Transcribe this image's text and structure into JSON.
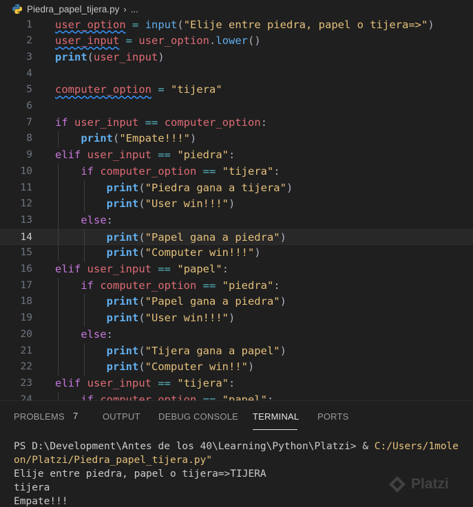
{
  "breadcrumb": {
    "filename": "Piedra_papel_tijera.py",
    "chevron": "›",
    "ellipsis": "..."
  },
  "editor": {
    "current_line": 14,
    "lines": [
      {
        "n": "1",
        "tokens": [
          [
            "v",
            "user_option"
          ],
          [
            "p",
            " "
          ],
          [
            "o",
            "="
          ],
          [
            "p",
            " "
          ],
          [
            "f",
            "input"
          ],
          [
            "p",
            "("
          ],
          [
            "s",
            "\"Elije entre piedra, papel o tijera=>\""
          ],
          [
            "p",
            ")"
          ]
        ]
      },
      {
        "n": "2",
        "tokens": [
          [
            "v",
            "user_input"
          ],
          [
            "p",
            " "
          ],
          [
            "o",
            "="
          ],
          [
            "p",
            " "
          ],
          [
            "v",
            "user_option"
          ],
          [
            "p",
            "."
          ],
          [
            "f",
            "lower"
          ],
          [
            "p",
            "()"
          ]
        ]
      },
      {
        "n": "3",
        "tokens": [
          [
            "b",
            "print"
          ],
          [
            "p",
            "("
          ],
          [
            "v",
            "user_input"
          ],
          [
            "p",
            ")"
          ]
        ]
      },
      {
        "n": "4",
        "tokens": []
      },
      {
        "n": "5",
        "tokens": [
          [
            "v",
            "computer_option"
          ],
          [
            "p",
            " "
          ],
          [
            "o",
            "="
          ],
          [
            "p",
            " "
          ],
          [
            "s",
            "\"tijera\""
          ]
        ]
      },
      {
        "n": "6",
        "tokens": []
      },
      {
        "n": "7",
        "tokens": [
          [
            "k",
            "if"
          ],
          [
            "p",
            " "
          ],
          [
            "v",
            "user_input"
          ],
          [
            "p",
            " "
          ],
          [
            "o",
            "=="
          ],
          [
            "p",
            " "
          ],
          [
            "v",
            "computer_option"
          ],
          [
            "p",
            ":"
          ]
        ]
      },
      {
        "n": "8",
        "tokens": [
          [
            "p",
            "    "
          ],
          [
            "b",
            "print"
          ],
          [
            "p",
            "("
          ],
          [
            "s",
            "\"Empate!!!\""
          ],
          [
            "p",
            ")"
          ]
        ]
      },
      {
        "n": "9",
        "tokens": [
          [
            "k",
            "elif"
          ],
          [
            "p",
            " "
          ],
          [
            "v",
            "user_input"
          ],
          [
            "p",
            " "
          ],
          [
            "o",
            "=="
          ],
          [
            "p",
            " "
          ],
          [
            "s",
            "\"piedra\""
          ],
          [
            "p",
            ":"
          ]
        ]
      },
      {
        "n": "10",
        "tokens": [
          [
            "p",
            "    "
          ],
          [
            "k",
            "if"
          ],
          [
            "p",
            " "
          ],
          [
            "v",
            "computer_option"
          ],
          [
            "p",
            " "
          ],
          [
            "o",
            "=="
          ],
          [
            "p",
            " "
          ],
          [
            "s",
            "\"tijera\""
          ],
          [
            "p",
            ":"
          ]
        ]
      },
      {
        "n": "11",
        "tokens": [
          [
            "p",
            "        "
          ],
          [
            "b",
            "print"
          ],
          [
            "p",
            "("
          ],
          [
            "s",
            "\"Piedra gana a tijera\""
          ],
          [
            "p",
            ")"
          ]
        ]
      },
      {
        "n": "12",
        "tokens": [
          [
            "p",
            "        "
          ],
          [
            "b",
            "print"
          ],
          [
            "p",
            "("
          ],
          [
            "s",
            "\"User win!!!\""
          ],
          [
            "p",
            ")"
          ]
        ]
      },
      {
        "n": "13",
        "tokens": [
          [
            "p",
            "    "
          ],
          [
            "k",
            "else"
          ],
          [
            "p",
            ":"
          ]
        ]
      },
      {
        "n": "14",
        "tokens": [
          [
            "p",
            "        "
          ],
          [
            "b",
            "print"
          ],
          [
            "p",
            "("
          ],
          [
            "s",
            "\"Papel gana a piedra\""
          ],
          [
            "p",
            ")"
          ]
        ]
      },
      {
        "n": "15",
        "tokens": [
          [
            "p",
            "        "
          ],
          [
            "b",
            "print"
          ],
          [
            "p",
            "("
          ],
          [
            "s",
            "\"Computer win!!!\""
          ],
          [
            "p",
            ")"
          ]
        ]
      },
      {
        "n": "16",
        "tokens": [
          [
            "k",
            "elif"
          ],
          [
            "p",
            " "
          ],
          [
            "v",
            "user_input"
          ],
          [
            "p",
            " "
          ],
          [
            "o",
            "=="
          ],
          [
            "p",
            " "
          ],
          [
            "s",
            "\"papel\""
          ],
          [
            "p",
            ":"
          ]
        ]
      },
      {
        "n": "17",
        "tokens": [
          [
            "p",
            "    "
          ],
          [
            "k",
            "if"
          ],
          [
            "p",
            " "
          ],
          [
            "v",
            "computer_option"
          ],
          [
            "p",
            " "
          ],
          [
            "o",
            "=="
          ],
          [
            "p",
            " "
          ],
          [
            "s",
            "\"piedra\""
          ],
          [
            "p",
            ":"
          ]
        ]
      },
      {
        "n": "18",
        "tokens": [
          [
            "p",
            "        "
          ],
          [
            "b",
            "print"
          ],
          [
            "p",
            "("
          ],
          [
            "s",
            "\"Papel gana a piedra\""
          ],
          [
            "p",
            ")"
          ]
        ]
      },
      {
        "n": "19",
        "tokens": [
          [
            "p",
            "        "
          ],
          [
            "b",
            "print"
          ],
          [
            "p",
            "("
          ],
          [
            "s",
            "\"User win!!!\""
          ],
          [
            "p",
            ")"
          ]
        ]
      },
      {
        "n": "20",
        "tokens": [
          [
            "p",
            "    "
          ],
          [
            "k",
            "else"
          ],
          [
            "p",
            ":"
          ]
        ]
      },
      {
        "n": "21",
        "tokens": [
          [
            "p",
            "        "
          ],
          [
            "b",
            "print"
          ],
          [
            "p",
            "("
          ],
          [
            "s",
            "\"Tijera gana a papel\""
          ],
          [
            "p",
            ")"
          ]
        ]
      },
      {
        "n": "22",
        "tokens": [
          [
            "p",
            "        "
          ],
          [
            "b",
            "print"
          ],
          [
            "p",
            "("
          ],
          [
            "s",
            "\"Computer win!!\""
          ],
          [
            "p",
            ")"
          ]
        ]
      },
      {
        "n": "23",
        "tokens": [
          [
            "k",
            "elif"
          ],
          [
            "p",
            " "
          ],
          [
            "v",
            "user_input"
          ],
          [
            "p",
            " "
          ],
          [
            "o",
            "=="
          ],
          [
            "p",
            " "
          ],
          [
            "s",
            "\"tijera\""
          ],
          [
            "p",
            ":"
          ]
        ]
      },
      {
        "n": "24",
        "tokens": [
          [
            "p",
            "    "
          ],
          [
            "k",
            "if"
          ],
          [
            "p",
            " "
          ],
          [
            "v",
            "computer_option"
          ],
          [
            "p",
            " "
          ],
          [
            "o",
            "=="
          ],
          [
            "p",
            " "
          ],
          [
            "s",
            "\"papel\""
          ],
          [
            "p",
            ":"
          ]
        ]
      }
    ]
  },
  "panel": {
    "tabs": [
      {
        "label": "PROBLEMS",
        "badge": "7",
        "active": false
      },
      {
        "label": "OUTPUT",
        "active": false
      },
      {
        "label": "DEBUG CONSOLE",
        "active": false
      },
      {
        "label": "TERMINAL",
        "active": true
      },
      {
        "label": "PORTS",
        "active": false
      }
    ]
  },
  "terminal": {
    "prompt": "PS D:\\Development\\Antes de los 40\\Learning\\Python\\Platzi> & ",
    "command_part1": "C:/Users/1mole",
    "command_part2": "on/Platzi/Piedra_papel_tijera.py\"",
    "output": [
      "Elije entre piedra, papel o tijera=>TIJERA",
      "tijera",
      "Empate!!!"
    ]
  },
  "watermark": {
    "text": "Platzi"
  },
  "colors": {
    "background": "#1f1f1f",
    "variable": "#e06c75",
    "operator": "#56b6c2",
    "function": "#61afef",
    "string": "#e5c07b",
    "keyword": "#c678dd",
    "squiggle": "#3794ff"
  },
  "icons": {
    "file_icon": "python-icon"
  }
}
